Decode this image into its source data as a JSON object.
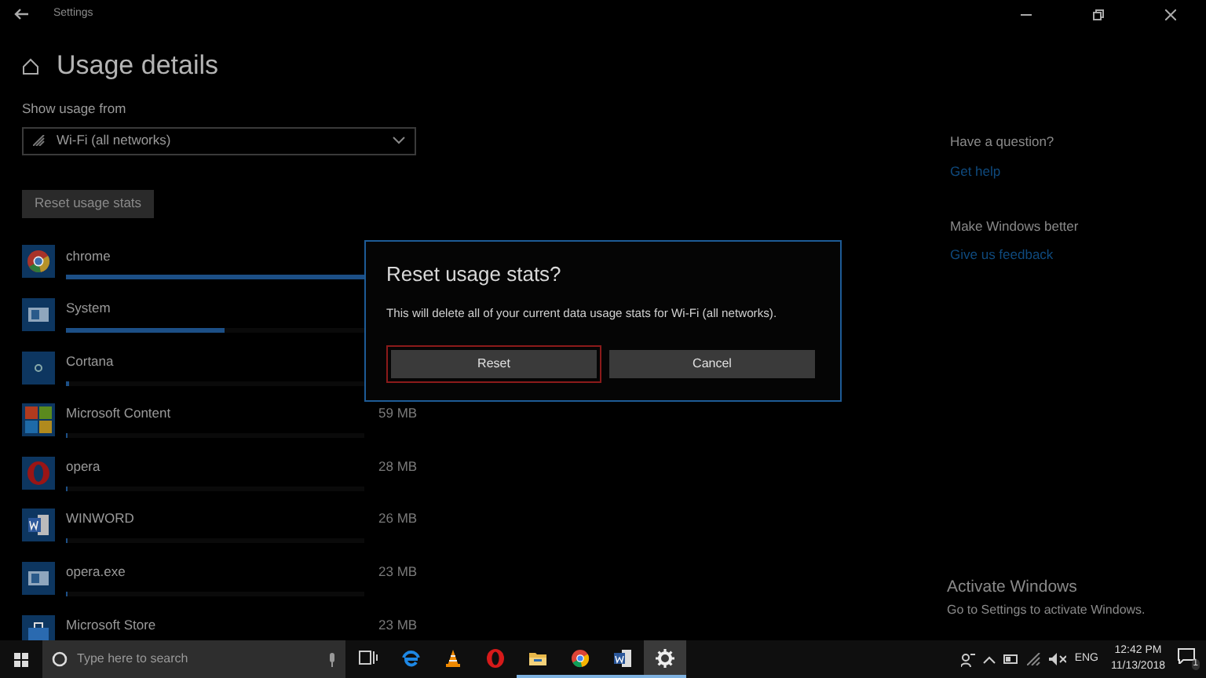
{
  "window": {
    "title": "Settings"
  },
  "page": {
    "title": "Usage details",
    "source_label": "Show usage from",
    "source_value": "Wi-Fi (all networks)",
    "reset_button": "Reset usage stats"
  },
  "apps": [
    {
      "kind": "chrome",
      "name": "chrome",
      "level": 1.0
    },
    {
      "kind": "system",
      "name": "System",
      "level": 0.53
    },
    {
      "kind": "cortana",
      "name": "Cortana",
      "level": 0.01
    },
    {
      "kind": "grid",
      "name": "Microsoft Content",
      "size": "59 MB",
      "level": 0.005
    },
    {
      "kind": "opera",
      "name": "opera",
      "size": "28 MB",
      "level": 0.004
    },
    {
      "kind": "word",
      "name": "WINWORD",
      "size": "26 MB",
      "level": 0.003
    },
    {
      "kind": "system",
      "name": "opera.exe",
      "size": "23 MB",
      "level": 0.003
    },
    {
      "kind": "store",
      "name": "Microsoft Store",
      "size": "23 MB"
    }
  ],
  "side": [
    {
      "heading": "Have a question?",
      "link": "Get help"
    },
    {
      "heading": "Make Windows better",
      "link": "Give us feedback"
    }
  ],
  "dialog": {
    "title": "Reset usage stats?",
    "message": "This will delete all of your current data usage stats for Wi-Fi (all networks).",
    "buttons": [
      {
        "label": "Reset",
        "focused": true
      },
      {
        "label": "Cancel",
        "focused": false
      }
    ]
  },
  "activation": {
    "title": "Activate Windows",
    "message": "Go to Settings to activate Windows."
  },
  "taskbar": {
    "search_placeholder": "Type here to search",
    "apps": [
      {
        "kind": "taskview",
        "running": false,
        "active": false
      },
      {
        "kind": "edge",
        "running": false,
        "active": false
      },
      {
        "kind": "vlc",
        "running": false,
        "active": false
      },
      {
        "kind": "opera",
        "running": false,
        "active": false
      },
      {
        "kind": "explorer",
        "running": true,
        "active": false
      },
      {
        "kind": "chrome",
        "running": true,
        "active": false
      },
      {
        "kind": "word",
        "running": true,
        "active": false
      },
      {
        "kind": "settings",
        "running": true,
        "active": true
      }
    ],
    "language": "ENG",
    "time": "12:42 PM",
    "date": "11/13/2018",
    "notifications": "1"
  }
}
